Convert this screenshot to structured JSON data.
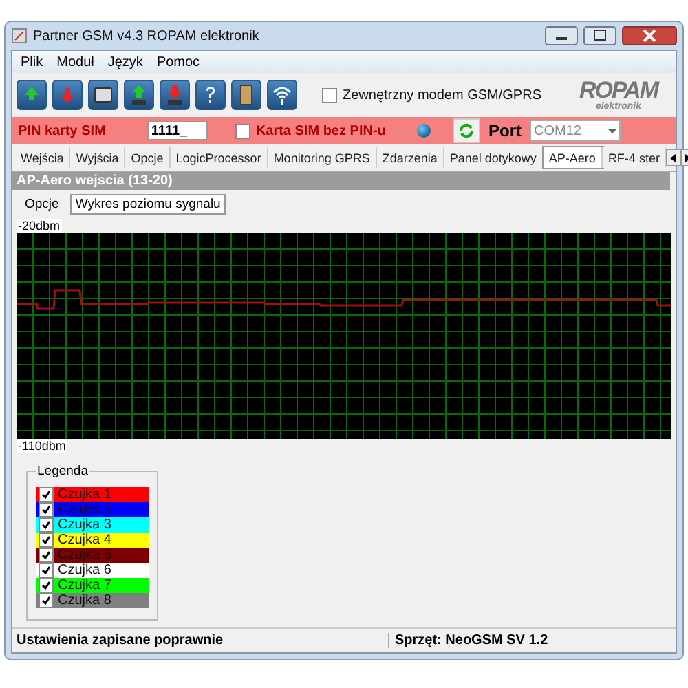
{
  "window": {
    "title": "Partner GSM v4.3 ROPAM elektronik"
  },
  "menu": [
    "Plik",
    "Moduł",
    "Język",
    "Pomoc"
  ],
  "toolbar": {
    "buttons": [
      {
        "kind": "upload"
      },
      {
        "kind": "download"
      },
      {
        "kind": "device"
      },
      {
        "kind": "upload-device"
      },
      {
        "kind": "download-device"
      },
      {
        "kind": "help"
      },
      {
        "kind": "exit"
      },
      {
        "kind": "wireless"
      }
    ],
    "external_modem": {
      "label": "Zewnętrzny modem GSM/GPRS",
      "checked": false
    },
    "logo": {
      "name": "ROPAM",
      "sub": "elektronik"
    }
  },
  "sim_bar": {
    "pin_label": "PIN karty SIM",
    "pin_value": "1111_",
    "no_pin": {
      "label": "Karta SIM bez PIN-u",
      "checked": false
    },
    "port_label": "Port",
    "port_value": "COM12"
  },
  "tabs": [
    {
      "label": "Wejścia",
      "selected": false
    },
    {
      "label": "Wyjścia",
      "selected": false
    },
    {
      "label": "Opcje",
      "selected": false
    },
    {
      "label": "LogicProcessor",
      "selected": false
    },
    {
      "label": "Monitoring GPRS",
      "selected": false
    },
    {
      "label": "Zdarzenia",
      "selected": false
    },
    {
      "label": "Panel dotykowy",
      "selected": false
    },
    {
      "label": "AP-Aero",
      "selected": true
    },
    {
      "label": "RF-4 ster",
      "selected": false
    }
  ],
  "section_title": "AP-Aero  wejscia  (13-20)",
  "subtabs": [
    {
      "label": "Opcje",
      "selected": false
    },
    {
      "label": "Wykres poziomu sygnału",
      "selected": true
    }
  ],
  "chart": {
    "top_label": "-20dbm",
    "bottom_label": "-110dbm"
  },
  "legend": {
    "title": "Legenda",
    "items": [
      {
        "label": "Czujka 1",
        "color": "#ff0000",
        "checked": true
      },
      {
        "label": "Czujka 2",
        "color": "#0000ff",
        "checked": true
      },
      {
        "label": "Czujka 3",
        "color": "#00ffff",
        "checked": true
      },
      {
        "label": "Czujka 4",
        "color": "#ffff00",
        "checked": true
      },
      {
        "label": "Czujka 5",
        "color": "#800000",
        "checked": true
      },
      {
        "label": "Czujka 6",
        "color": "#ffffff",
        "checked": true
      },
      {
        "label": "Czujka 7",
        "color": "#00ff00",
        "checked": true
      },
      {
        "label": "Czujka 8",
        "color": "#808080",
        "checked": true
      }
    ]
  },
  "status_bar": [
    "Ustawienia zapisane poprawnie",
    "Sprzęt: NeoGSM SV 1.2"
  ]
}
